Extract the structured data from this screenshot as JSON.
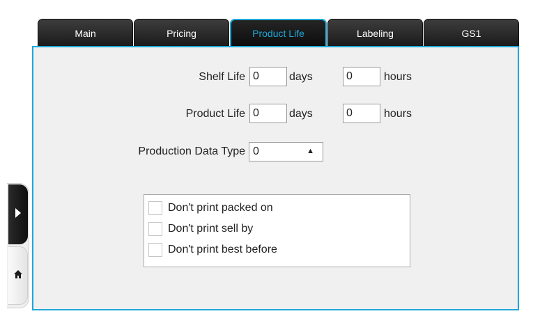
{
  "tabs": [
    {
      "label": "Main",
      "active": false
    },
    {
      "label": "Pricing",
      "active": false
    },
    {
      "label": "Product Life",
      "active": true
    },
    {
      "label": "Labeling",
      "active": false
    },
    {
      "label": "GS1",
      "active": false
    }
  ],
  "form": {
    "shelf_life": {
      "label": "Shelf Life",
      "days_value": "0",
      "days_unit": "days",
      "hours_value": "0",
      "hours_unit": "hours"
    },
    "product_life": {
      "label": "Product Life",
      "days_value": "0",
      "days_unit": "days",
      "hours_value": "0",
      "hours_unit": "hours"
    },
    "production_data_type": {
      "label": "Production Data Type",
      "selected": "0"
    }
  },
  "options": [
    {
      "label": "Don't print packed on",
      "checked": false
    },
    {
      "label": "Don't print sell by",
      "checked": false
    },
    {
      "label": "Don't print best before",
      "checked": false
    }
  ],
  "colors": {
    "accent": "#1ea7d8",
    "tab_bg": "#1e1e1e",
    "panel_bg": "#f0f0f0"
  },
  "icons": {
    "expand": "chevron-right-icon",
    "home": "home-icon",
    "select_arrow": "up-down-arrow-icon"
  }
}
